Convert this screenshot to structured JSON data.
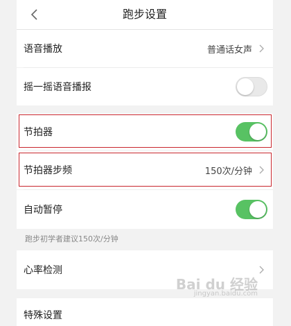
{
  "header": {
    "title": "跑步设置"
  },
  "settings": {
    "voice_broadcast": {
      "label": "语音播放",
      "value": "普通话女声"
    },
    "shake_voice": {
      "label": "摇一摇语音播报",
      "enabled": false
    },
    "metronome": {
      "label": "节拍器",
      "enabled": true
    },
    "metronome_cadence": {
      "label": "节拍器步频",
      "value": "150次/分钟"
    },
    "auto_pause": {
      "label": "自动暂停",
      "enabled": true
    },
    "hint": "跑步初学者建议150次/分钟",
    "heart_rate": {
      "label": "心率检测"
    },
    "partial_row": {
      "label": "特殊设置"
    }
  },
  "watermark": {
    "text": "Bai du 经验",
    "sub": "jingyan.baidu.com"
  },
  "colors": {
    "toggle_on": "#58c263",
    "highlight": "#c8252c"
  },
  "icons": {
    "back": "chevron-left-icon",
    "row_arrow": "chevron-right-icon"
  }
}
